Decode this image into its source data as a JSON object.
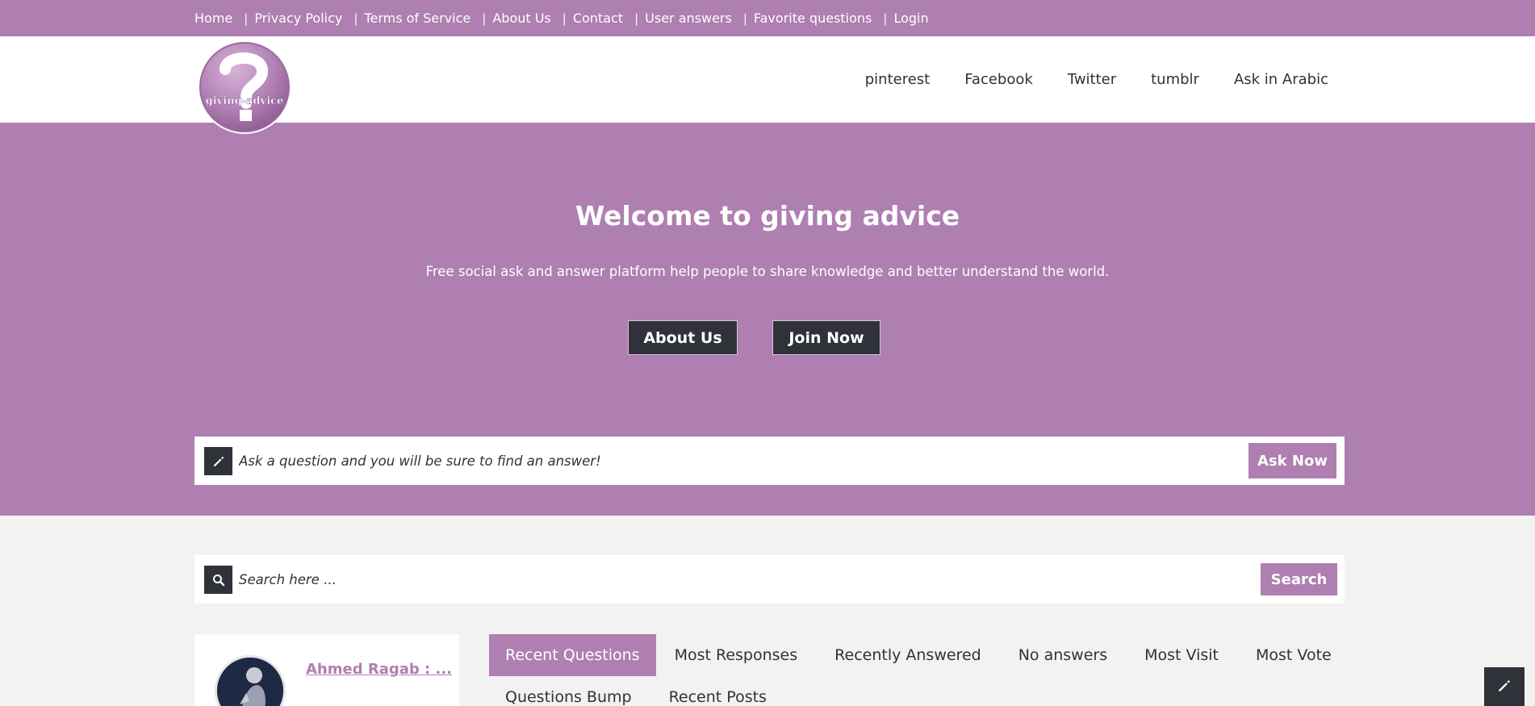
{
  "topnav": {
    "items": [
      "Home",
      "Privacy Policy",
      "Terms of Service",
      "About Us",
      "Contact",
      "User answers",
      "Favorite questions",
      "Login"
    ]
  },
  "logo": {
    "text": "giving-advice"
  },
  "mainnav": {
    "items": [
      "pinterest",
      "Facebook",
      "Twitter",
      "tumblr",
      "Ask in Arabic"
    ]
  },
  "hero": {
    "title": "Welcome to giving advice",
    "subtitle": "Free social ask and answer platform help people to share knowledge and better understand the world.",
    "about_label": "About Us",
    "join_label": "Join Now"
  },
  "ask": {
    "placeholder": "Ask a question and you will be sure to find an answer!",
    "button_label": "Ask Now",
    "icon": "pencil-icon"
  },
  "search": {
    "placeholder": "Search here ...",
    "button_label": "Search",
    "icon": "search-icon"
  },
  "usercard": {
    "name": "Ahmed Ragab : ..."
  },
  "tabs": {
    "row1": [
      "Recent Questions",
      "Most Responses",
      "Recently Answered",
      "No answers",
      "Most Visit",
      "Most Vote"
    ],
    "row2": [
      "Questions Bump",
      "Recent Posts"
    ],
    "active": "Recent Questions"
  },
  "colors": {
    "accent": "#ae7fb0",
    "dark": "#2f3239",
    "background": "#f2f2f2"
  }
}
